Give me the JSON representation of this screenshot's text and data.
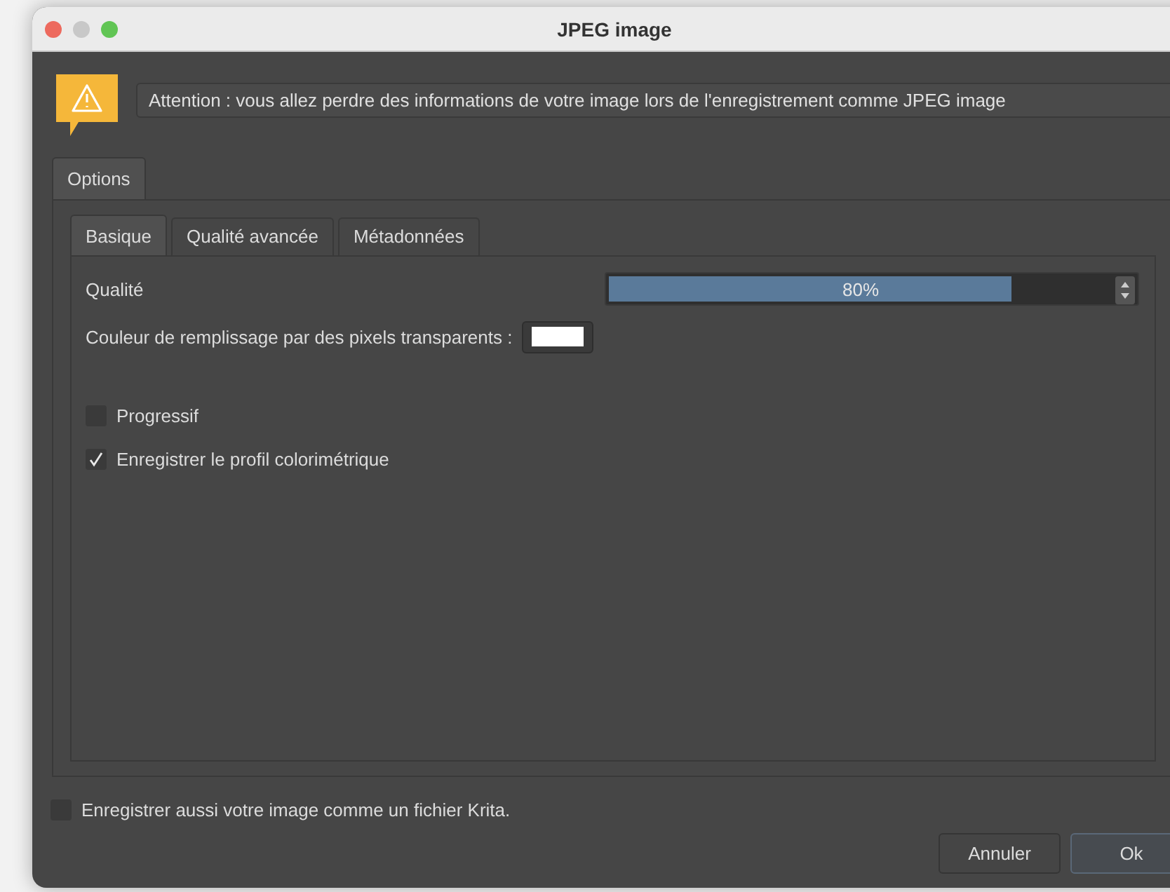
{
  "window": {
    "title": "JPEG image"
  },
  "warning": {
    "text": "Attention : vous allez perdre des informations de votre image lors de l'enregistrement comme JPEG image"
  },
  "outer_tabs": [
    {
      "label": "Options",
      "selected": true
    }
  ],
  "tabs": [
    {
      "label": "Basique",
      "selected": true
    },
    {
      "label": "Qualité avancée",
      "selected": false
    },
    {
      "label": "Métadonnées",
      "selected": false
    }
  ],
  "quality": {
    "label": "Qualité",
    "level": 0.8,
    "reading": "80%"
  },
  "fill_color": {
    "label": "Couleur de remplissage par des pixels transparents :",
    "color": "#ffffff"
  },
  "options": [
    {
      "label": "Progressif",
      "checked": false
    },
    {
      "label": "Enregistrer le profil colorimétrique",
      "checked": true
    }
  ],
  "save_krita": {
    "label": "Enregistrer aussi votre image comme un fichier Krita.",
    "checked": false
  },
  "buttons": [
    {
      "label": "Annuler",
      "kind": "normal"
    },
    {
      "label": "Ok",
      "kind": "default"
    }
  ]
}
